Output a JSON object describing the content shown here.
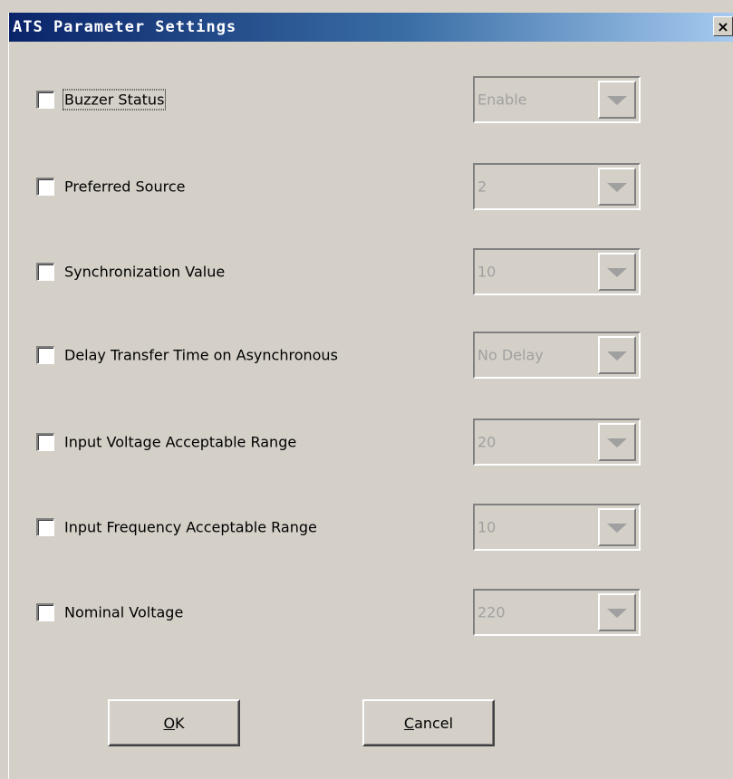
{
  "window": {
    "title": "ATS Parameter Settings",
    "close_glyph": "×"
  },
  "settings": [
    {
      "label": "Buzzer Status",
      "value": "Enable",
      "checked": false
    },
    {
      "label": "Preferred Source",
      "value": "2",
      "checked": false
    },
    {
      "label": "Synchronization Value",
      "value": "10",
      "checked": false
    },
    {
      "label": "Delay Transfer Time on Asynchronous",
      "value": "No Delay",
      "checked": false
    },
    {
      "label": "Input Voltage Acceptable Range",
      "value": "20",
      "checked": false
    },
    {
      "label": "Input Frequency Acceptable Range",
      "value": "10",
      "checked": false
    },
    {
      "label": "Nominal Voltage",
      "value": "220",
      "checked": false
    }
  ],
  "buttons": {
    "ok": {
      "mnemonic": "O",
      "rest": "K"
    },
    "cancel": {
      "mnemonic": "C",
      "rest": "ancel"
    }
  },
  "colors": {
    "dialog_bg": "#d4d0c8",
    "title_start": "#0a246a",
    "title_end": "#a6caf0",
    "disabled_text": "#a0a0a0"
  },
  "icons": {
    "close": "close-icon",
    "dropdown": "chevron-down-icon"
  }
}
